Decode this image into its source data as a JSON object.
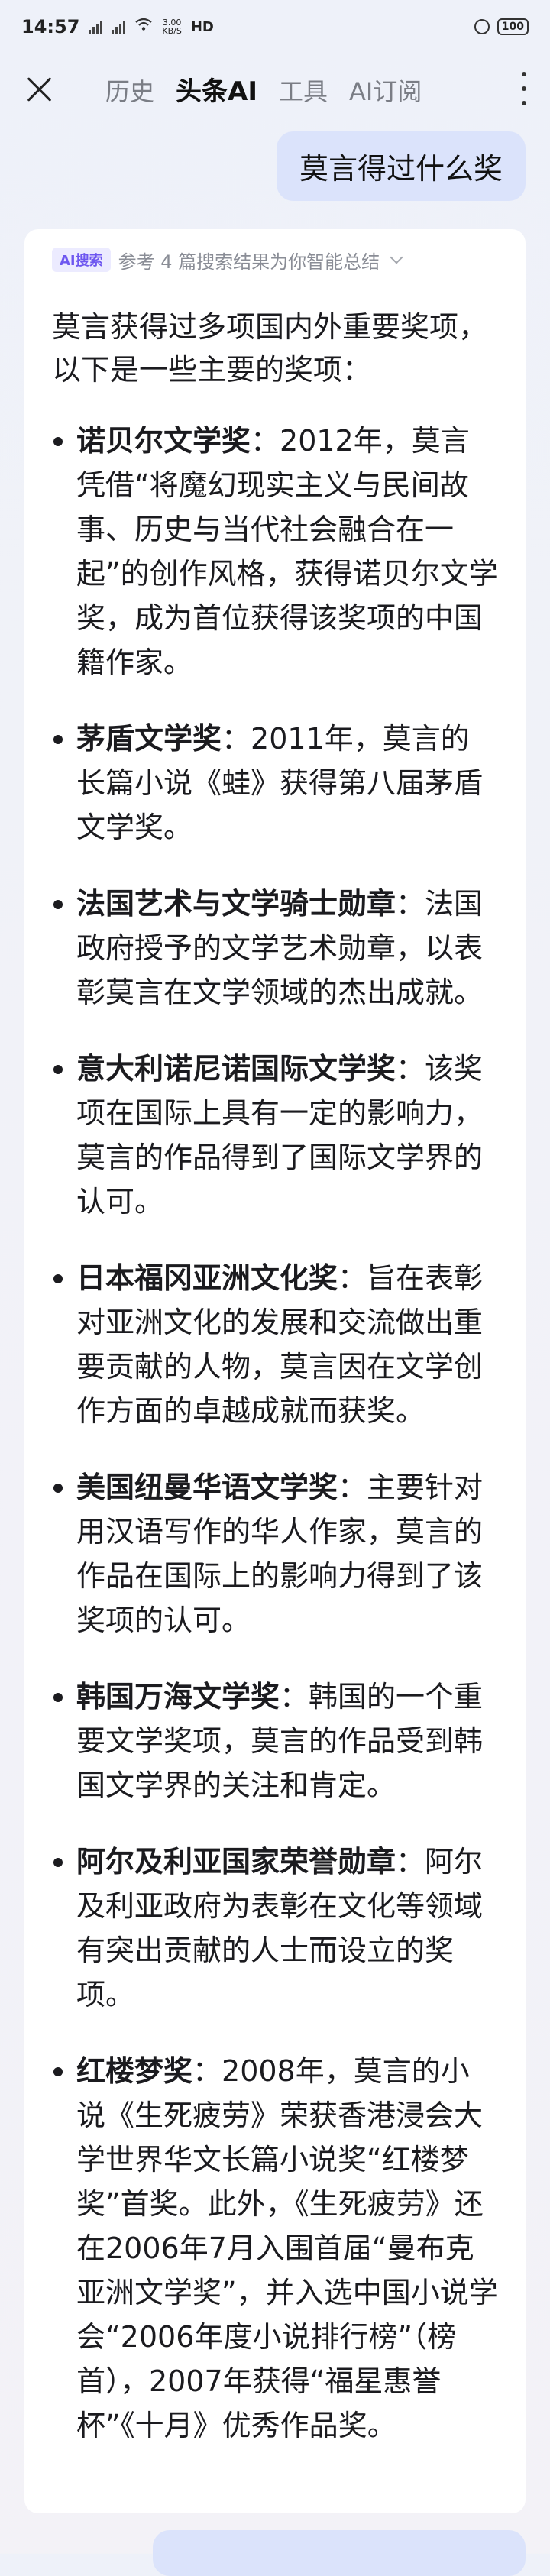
{
  "status_bar": {
    "time": "14:57",
    "net_speed": "3.00",
    "net_unit": "KB/S",
    "hd": "HD",
    "battery": "100"
  },
  "nav": {
    "tabs": [
      {
        "label": "历史"
      },
      {
        "label": "头条AI"
      },
      {
        "label": "工具"
      },
      {
        "label": "AI订阅"
      }
    ]
  },
  "chat": {
    "question": "莫言得过什么奖",
    "source": {
      "badge": "AI搜索",
      "text": "参考 4 篇搜索结果为你智能总结"
    },
    "intro": "莫言获得过多项国内外重要奖项，以下是一些主要的奖项：",
    "awards": [
      {
        "title": "诺贝尔文学奖",
        "desc": "：2012年，莫言凭借“将魔幻现实主义与民间故事、历史与当代社会融合在一起”的创作风格，获得诺贝尔文学奖，成为首位获得该奖项的中国籍作家。"
      },
      {
        "title": "茅盾文学奖",
        "desc": "：2011年，莫言的长篇小说《蛙》获得第八届茅盾文学奖。"
      },
      {
        "title": "法国艺术与文学骑士勋章",
        "desc": "：法国政府授予的文学艺术勋章，以表彰莫言在文学领域的杰出成就。"
      },
      {
        "title": "意大利诺尼诺国际文学奖",
        "desc": "：该奖项在国际上具有一定的影响力，莫言的作品得到了国际文学界的认可。"
      },
      {
        "title": "日本福冈亚洲文化奖",
        "desc": "：旨在表彰对亚洲文化的发展和交流做出重要贡献的人物，莫言因在文学创作方面的卓越成就而获奖。"
      },
      {
        "title": "美国纽曼华语文学奖",
        "desc": "：主要针对用汉语写作的华人作家，莫言的作品在国际上的影响力得到了该奖项的认可。"
      },
      {
        "title": "韩国万海文学奖",
        "desc": "：韩国的一个重要文学奖项，莫言的作品受到韩国文学界的关注和肯定。"
      },
      {
        "title": "阿尔及利亚国家荣誉勋章",
        "desc": "：阿尔及利亚政府为表彰在文化等领域有突出贡献的人士而设立的奖项。"
      },
      {
        "title": "红楼梦奖",
        "desc": "：2008年，莫言的小说《生死疲劳》荣获香港浸会大学世界华文长篇小说奖“红楼梦奖”首奖。此外，《生死疲劳》还在2006年7月入围首届“曼布克亚洲文学奖”，并入选中国小说学会“2006年度小说排行榜”（榜首），2007年获得“福星惠誉杯”《十月》优秀作品奖。"
      }
    ]
  }
}
